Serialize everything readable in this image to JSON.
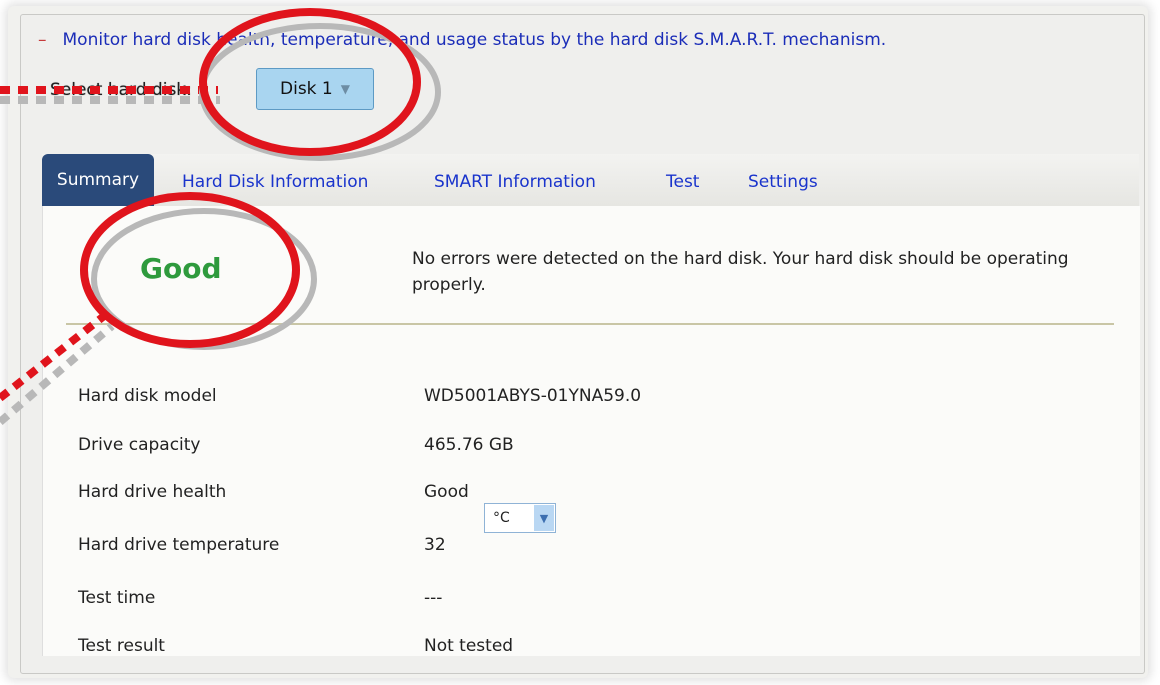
{
  "header": {
    "collapse_glyph": "–",
    "description": "Monitor hard disk health, temperature, and usage status by the hard disk S.M.A.R.T. mechanism."
  },
  "disk_select": {
    "label": "Select hard disk:",
    "value": "Disk 1",
    "caret": "▼"
  },
  "tabs": [
    {
      "label": "Summary",
      "active": true
    },
    {
      "label": "Hard Disk Information",
      "active": false
    },
    {
      "label": "SMART Information",
      "active": false
    },
    {
      "label": "Test",
      "active": false
    },
    {
      "label": "Settings",
      "active": false
    }
  ],
  "summary": {
    "status": "Good",
    "message": "No errors were detected on the hard disk. Your hard disk should be operating properly."
  },
  "details": [
    {
      "label": "Hard disk model",
      "value": "WD5001ABYS-01YNA59.0"
    },
    {
      "label": "Drive capacity",
      "value": "465.76 GB"
    },
    {
      "label": "Hard drive health",
      "value": "Good"
    },
    {
      "label": "Hard drive temperature",
      "value": "32"
    },
    {
      "label": "Test time",
      "value": "---"
    },
    {
      "label": "Test result",
      "value": "Not tested"
    }
  ],
  "temperature_unit": {
    "value": "°C",
    "caret": "▼"
  },
  "colors": {
    "accent_link": "#1a34cc",
    "active_tab": "#2a4a7a",
    "status_good": "#2e9a3d",
    "annotation_red": "#e0141c",
    "annotation_gray": "#b8b8b8"
  }
}
